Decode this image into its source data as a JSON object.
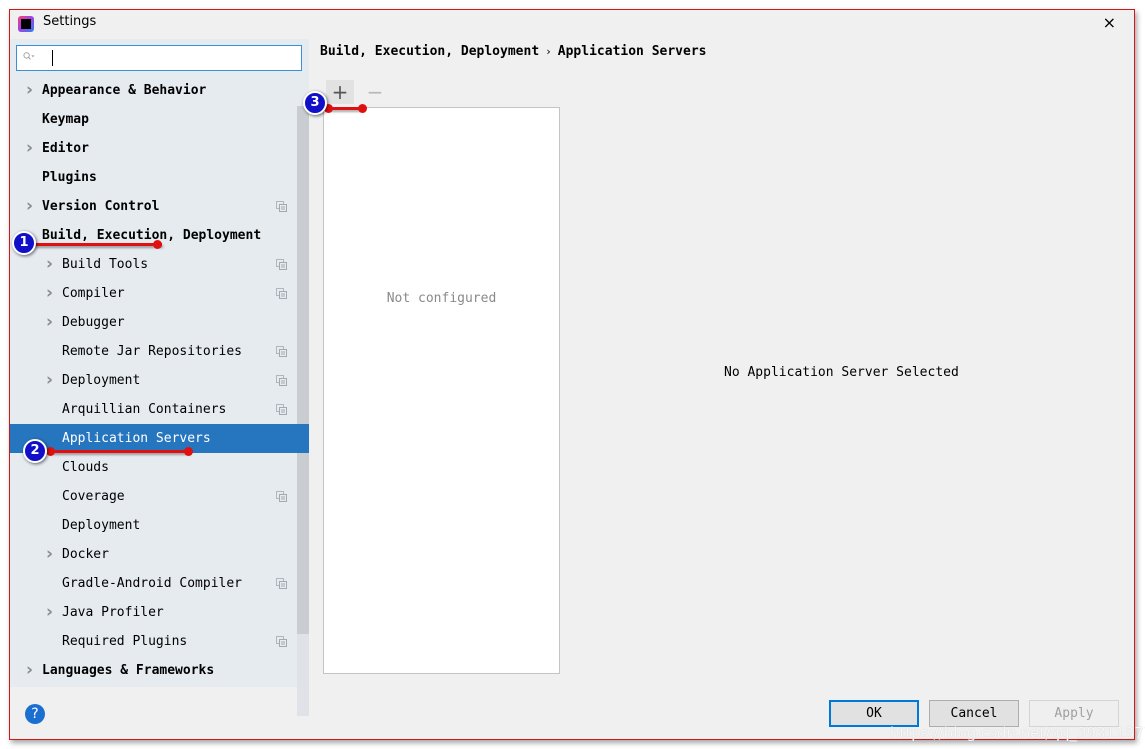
{
  "window": {
    "title": "Settings",
    "close_label": "×"
  },
  "search": {
    "value": "",
    "placeholder": ""
  },
  "sidebar": {
    "items": [
      {
        "label": "Appearance & Behavior",
        "level": 0,
        "expandable": true,
        "expanded": false,
        "bold": true,
        "project_icon": false
      },
      {
        "label": "Keymap",
        "level": 0,
        "expandable": false,
        "bold": true,
        "project_icon": false
      },
      {
        "label": "Editor",
        "level": 0,
        "expandable": true,
        "expanded": false,
        "bold": true,
        "project_icon": false
      },
      {
        "label": "Plugins",
        "level": 0,
        "expandable": false,
        "bold": true,
        "project_icon": false
      },
      {
        "label": "Version Control",
        "level": 0,
        "expandable": true,
        "expanded": false,
        "bold": true,
        "project_icon": true
      },
      {
        "label": "Build, Execution, Deployment",
        "level": 0,
        "expandable": true,
        "expanded": true,
        "bold": true,
        "project_icon": false
      },
      {
        "label": "Build Tools",
        "level": 1,
        "expandable": true,
        "expanded": false,
        "bold": false,
        "project_icon": true
      },
      {
        "label": "Compiler",
        "level": 1,
        "expandable": true,
        "expanded": false,
        "bold": false,
        "project_icon": true
      },
      {
        "label": "Debugger",
        "level": 1,
        "expandable": true,
        "expanded": false,
        "bold": false,
        "project_icon": false
      },
      {
        "label": "Remote Jar Repositories",
        "level": 1,
        "expandable": false,
        "bold": false,
        "project_icon": true
      },
      {
        "label": "Deployment",
        "level": 1,
        "expandable": true,
        "expanded": false,
        "bold": false,
        "project_icon": true
      },
      {
        "label": "Arquillian Containers",
        "level": 1,
        "expandable": false,
        "bold": false,
        "project_icon": true
      },
      {
        "label": "Application Servers",
        "level": 1,
        "expandable": false,
        "bold": false,
        "project_icon": false,
        "selected": true
      },
      {
        "label": "Clouds",
        "level": 1,
        "expandable": false,
        "bold": false,
        "project_icon": false
      },
      {
        "label": "Coverage",
        "level": 1,
        "expandable": false,
        "bold": false,
        "project_icon": true
      },
      {
        "label": "Deployment",
        "level": 1,
        "expandable": false,
        "bold": false,
        "project_icon": false
      },
      {
        "label": "Docker",
        "level": 1,
        "expandable": true,
        "expanded": false,
        "bold": false,
        "project_icon": false
      },
      {
        "label": "Gradle-Android Compiler",
        "level": 1,
        "expandable": false,
        "bold": false,
        "project_icon": true
      },
      {
        "label": "Java Profiler",
        "level": 1,
        "expandable": true,
        "expanded": false,
        "bold": false,
        "project_icon": false
      },
      {
        "label": "Required Plugins",
        "level": 1,
        "expandable": false,
        "bold": false,
        "project_icon": true
      },
      {
        "label": "Languages & Frameworks",
        "level": 0,
        "expandable": true,
        "expanded": false,
        "bold": true,
        "project_icon": false
      }
    ]
  },
  "breadcrumb": {
    "parent": "Build, Execution, Deployment",
    "separator": "›",
    "current": "Application Servers"
  },
  "toolbar": {
    "add_label": "+",
    "remove_label": "−"
  },
  "server_list": {
    "empty_text": "Not configured"
  },
  "detail": {
    "empty_text": "No Application Server Selected"
  },
  "footer": {
    "help_label": "?",
    "ok_label": "OK",
    "cancel_label": "Cancel",
    "apply_label": "Apply",
    "watermark": "https://blog.csdn.net/qq_39311377"
  },
  "annotations": [
    {
      "number": "1",
      "target": "Build, Execution, Deployment"
    },
    {
      "number": "2",
      "target": "Application Servers"
    },
    {
      "number": "3",
      "target": "add-button"
    }
  ],
  "colors": {
    "selection": "#2675bf",
    "sidebar_bg": "#e6ebf0",
    "annotation_red": "#e01010",
    "annotation_blue": "#1010c8",
    "focus_border": "#0078d7"
  }
}
